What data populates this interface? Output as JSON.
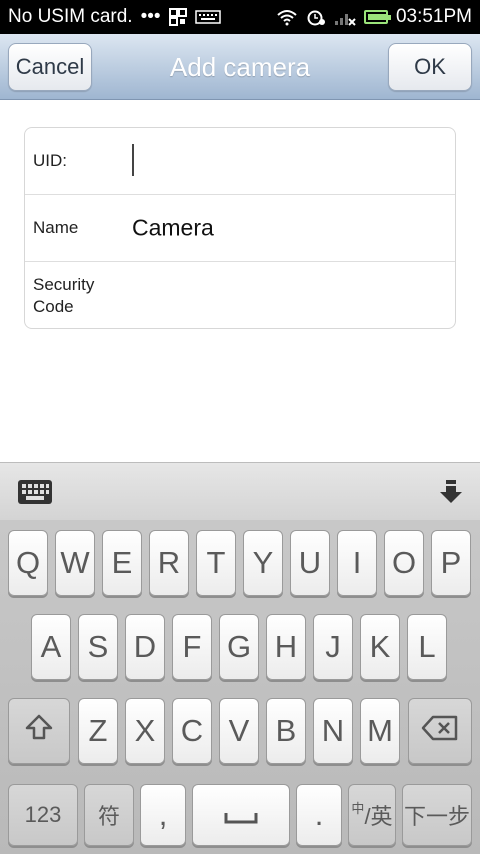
{
  "status_bar": {
    "carrier": "No USIM card.",
    "dots": "•••",
    "time": "03:51PM",
    "battery_level": 1.0,
    "icons": [
      "qr-icon",
      "keyboard-icon",
      "wifi-icon",
      "alarm-icon",
      "signal-icon",
      "battery-icon"
    ]
  },
  "title_bar": {
    "cancel_label": "Cancel",
    "title": "Add camera",
    "ok_label": "OK"
  },
  "form": {
    "uid_label": "UID:",
    "uid_value": "",
    "name_label": "Name",
    "name_value": "Camera",
    "security_label": "Security Code",
    "security_value": ""
  },
  "keyboard": {
    "row1": [
      "Q",
      "W",
      "E",
      "R",
      "T",
      "Y",
      "U",
      "I",
      "O",
      "P"
    ],
    "row2": [
      "A",
      "S",
      "D",
      "F",
      "G",
      "H",
      "J",
      "K",
      "L"
    ],
    "row3": [
      "Z",
      "X",
      "C",
      "V",
      "B",
      "N",
      "M"
    ],
    "num_label": "123",
    "symbol_label": "符",
    "comma_label": ",",
    "period_label": ".",
    "lang_label_top": "中",
    "lang_label_main": "/英",
    "next_label": "下一步"
  }
}
